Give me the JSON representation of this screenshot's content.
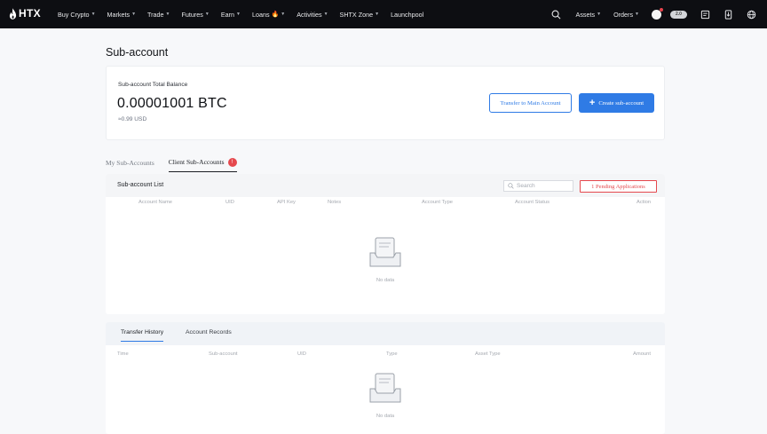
{
  "brand": {
    "name": "HTX"
  },
  "nav": {
    "items": [
      {
        "label": "Buy Crypto",
        "caret": true
      },
      {
        "label": "Markets",
        "caret": true
      },
      {
        "label": "Trade",
        "caret": true
      },
      {
        "label": "Futures",
        "caret": true
      },
      {
        "label": "Earn",
        "caret": true
      },
      {
        "label": "Loans",
        "caret": true,
        "fire": true
      },
      {
        "label": "Activities",
        "caret": true
      },
      {
        "label": "SHTX Zone",
        "caret": true
      },
      {
        "label": "Launchpool",
        "caret": false
      }
    ],
    "right": {
      "assets_label": "Assets",
      "orders_label": "Orders",
      "pill_text": "2.0"
    }
  },
  "page": {
    "title": "Sub-account"
  },
  "balance": {
    "label": "Sub-account Total Balance",
    "value": "0.00001001 BTC",
    "usd": "≈0.99 USD",
    "transfer_label": "Transfer to Main Account",
    "create_label": "Create sub-account"
  },
  "tabs": {
    "my": "My Sub-Accounts",
    "client": "Client Sub-Accounts",
    "client_badge": "!"
  },
  "list": {
    "title": "Sub-account List",
    "search_placeholder": "Search",
    "pending_label": "1 Pending Applications",
    "columns": [
      "Account Name",
      "UID",
      "API Key",
      "Notes",
      "Account Type",
      "Account Status",
      "Action"
    ],
    "empty_text": "No data"
  },
  "history": {
    "tabs": [
      "Transfer History",
      "Account Records"
    ],
    "columns": [
      "Time",
      "Sub-account",
      "UID",
      "Type",
      "Asset Type",
      "Amount"
    ],
    "empty_text": "No data"
  },
  "colors": {
    "accent": "#2f7be5",
    "alert": "#e5484d",
    "nav_bg": "#0d0e12"
  }
}
